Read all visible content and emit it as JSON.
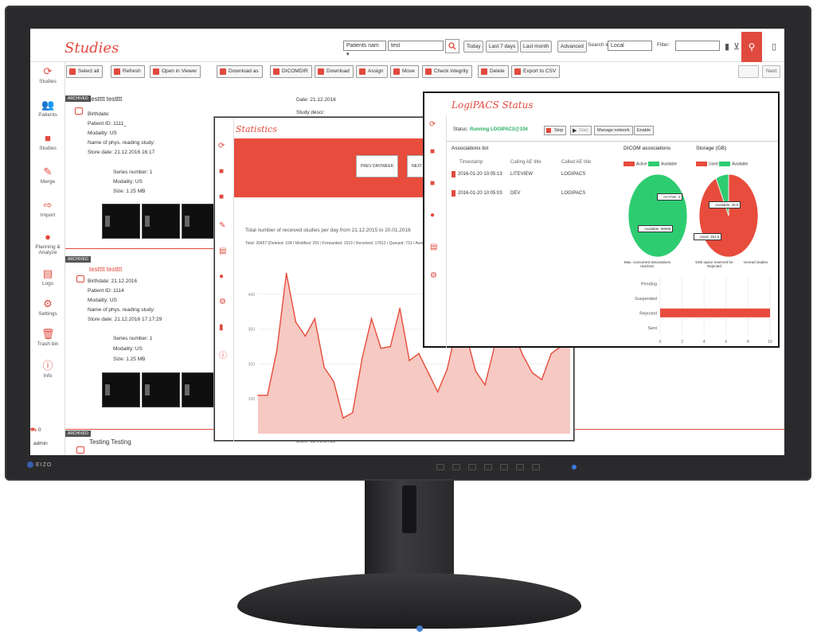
{
  "app": {
    "title": "Studies"
  },
  "topbar": {
    "search_select": "Patients nam ▾",
    "search_value": "test",
    "today": "Today",
    "last7": "Last 7 days",
    "last_month": "Last month",
    "advanced": "Advanced",
    "search_in_label": "Search in:",
    "search_in_value": "Local",
    "filter_label": "Filter:",
    "filter_value": ""
  },
  "sidebar": {
    "items": [
      {
        "label": "Studies",
        "icon": "logo-icon"
      },
      {
        "label": "Patients",
        "icon": "patients-icon"
      },
      {
        "label": "Studies",
        "icon": "studies-icon"
      },
      {
        "label": "Merge",
        "icon": "merge-icon"
      },
      {
        "label": "Import",
        "icon": "import-icon"
      },
      {
        "label": "Planning & Analyze",
        "icon": "analyze-icon"
      },
      {
        "label": "Logs",
        "icon": "logs-icon"
      },
      {
        "label": "Settings",
        "icon": "settings-icon"
      },
      {
        "label": "Trash bin",
        "icon": "trash-icon"
      },
      {
        "label": "Info",
        "icon": "info-icon"
      }
    ],
    "user": "admin",
    "count": "0"
  },
  "actions": {
    "select_all": "Select all",
    "refresh": "Refresh",
    "open_viewer": "Open in Viewer",
    "download_as": "Download as",
    "dicomdir": "DICOMDIR",
    "download": "Download",
    "assign": "Assign",
    "move": "Move",
    "check_integrity": "Check integrity",
    "delete": "Delete",
    "export_csv": "Export to CSV",
    "right1": "",
    "right2": "Next"
  },
  "studies": [
    {
      "tag": "ARCHIVED",
      "name": "testttt testttt",
      "birthdate": "Birthdate:",
      "patient_id": "Patient ID: 1111_",
      "modality": "Modality: US",
      "phys": "Name of phys. reading study:",
      "store": "Store date: 21.12.2016 16:17",
      "date": "Date: 21.12.2016",
      "study_desc": "Study descr:",
      "series_number": "Series number: 1",
      "series_modality": "Modality: US",
      "series_size": "Size: 1.25 MB"
    },
    {
      "tag": "ARCHIVED",
      "name": "testttt testttt",
      "birthdate": "Birthdate: 21.12.2016",
      "patient_id": "Patient ID: 1114",
      "modality": "Modality: US",
      "phys": "Name of phys. reading study:",
      "store": "Store date: 21.12.2016 17:17:29",
      "series_number": "Series number: 1",
      "series_modality": "Modality: US",
      "series_size": "Size: 1.25 MB"
    },
    {
      "tag": "ARCHIVED",
      "name": "Testing Testing",
      "date": "Date: 11.02.2015"
    }
  ],
  "statistics": {
    "title": "Statistics",
    "text1": "Total number of received studies per day from 21.12.2015 to 20.01.2016",
    "text2": "Total: 20457 (Deleted: 104 / Modified: 291 / Forwarded: 1519 / Received: 17812 / Queued: 731 / Average...",
    "btn1": "PREV DAY/WEEK",
    "btn2": "NEXT",
    "y_ticks": [
      "400",
      "300",
      "200",
      "100"
    ]
  },
  "status": {
    "title": "LogiPACS Status",
    "status_label": "Status:",
    "status_value": "Running LOGIPACS@104",
    "stop": "Stop",
    "start": "Start",
    "manage_network": "Manage network",
    "enable": "Enable",
    "assoc_title": "Associations list",
    "assoc_cols": [
      "Timestamp",
      "Calling AE title",
      "Called AE title"
    ],
    "assoc_rows": [
      [
        "2016-01-20 10:05:13",
        "LITEVIEW",
        "LOGIPACS"
      ],
      [
        "2016-01-20 10:05:03",
        "DEV",
        "LOGIPACS"
      ]
    ],
    "dicom_title": "DICOM associations",
    "storage_title": "Storage (GB)",
    "legend_active": "Active",
    "legend_available": "Available",
    "legend_used": "Used",
    "pie1_used": "ACTIVE: 2",
    "pie1_avail": "Available: 99998",
    "pie2_avail": "Available: 28.8",
    "pie2_used": "Used: 381.5",
    "note1": "Max. concurrent associations reached:",
    "note2": "Disk space reserved for Rejected",
    "note3": "Unread studies",
    "bar_categories": [
      "Pending",
      "Suspended",
      "Rejected",
      "Sent"
    ],
    "bar_x_ticks": [
      "0",
      "2",
      "4",
      "6",
      "8",
      "10"
    ]
  },
  "chart_data": [
    {
      "type": "area",
      "title": "",
      "xlabel": "",
      "ylabel": "",
      "x": [
        1,
        2,
        3,
        4,
        5,
        6,
        7,
        8,
        9,
        10,
        11,
        12,
        13,
        14,
        15,
        16,
        17,
        18,
        19,
        20,
        21,
        22,
        23,
        24,
        25,
        26,
        27,
        28,
        29,
        30,
        31,
        32,
        33,
        34
      ],
      "values": [
        110,
        110,
        240,
        460,
        320,
        280,
        330,
        190,
        150,
        45,
        60,
        215,
        330,
        245,
        250,
        360,
        210,
        230,
        175,
        120,
        185,
        305,
        285,
        180,
        140,
        250,
        340,
        290,
        225,
        175,
        155,
        230,
        250,
        270
      ],
      "ylim": [
        0,
        500
      ],
      "color": "#e74c3c"
    },
    {
      "type": "pie",
      "title": "DICOM associations",
      "labels": [
        "Active",
        "Available"
      ],
      "values": [
        2,
        99998
      ],
      "colors": [
        "#e74c3c",
        "#2ecc71"
      ]
    },
    {
      "type": "pie",
      "title": "Storage (GB)",
      "labels": [
        "Used",
        "Available"
      ],
      "values": [
        381.5,
        28.8
      ],
      "colors": [
        "#e74c3c",
        "#2ecc71"
      ]
    },
    {
      "type": "bar",
      "orientation": "horizontal",
      "categories": [
        "Pending",
        "Suspended",
        "Rejected",
        "Sent"
      ],
      "values": [
        0,
        0,
        10,
        0
      ],
      "xlim": [
        0,
        10
      ],
      "color": "#e74c3c"
    }
  ]
}
